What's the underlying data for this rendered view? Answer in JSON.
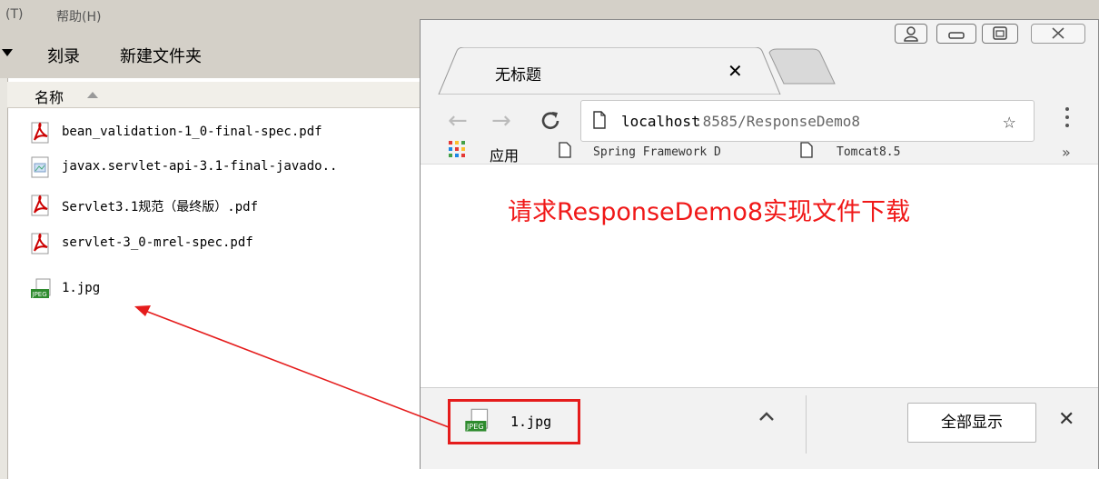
{
  "explorer": {
    "menu": [
      {
        "label": "(T)"
      },
      {
        "label": "帮助(H)"
      }
    ],
    "toolbar": {
      "burn_label": "刻录",
      "new_folder_label": "新建文件夹"
    },
    "column_header": "名称",
    "files": [
      {
        "name": "bean_validation-1_0-final-spec.pdf",
        "icon": "pdf-icon"
      },
      {
        "name": "javax.servlet-api-3.1-final-javado..",
        "icon": "image-file-icon"
      },
      {
        "name": "Servlet3.1规范（最终版）.pdf",
        "icon": "pdf-icon"
      },
      {
        "name": "servlet-3_0-mrel-spec.pdf",
        "icon": "pdf-icon"
      },
      {
        "name": "1.jpg",
        "icon": "jpeg-icon"
      }
    ]
  },
  "browser": {
    "tab_title": "无标题",
    "url_host": "localhost",
    "url_rest": ":8585/ResponseDemo8",
    "bookmarks": {
      "apps_label": "应用",
      "items": [
        "Spring Framework D",
        "Tomcat8.5"
      ],
      "overflow": "»"
    },
    "page_heading": "请求ResponseDemo8实现文件下载",
    "downloads": {
      "file_name": "1.jpg",
      "show_all_label": "全部显示"
    }
  },
  "colors": {
    "heading_red": "#f01818",
    "highlight_red": "#e51c1c",
    "window_frame": "#f2f2f2",
    "explorer_chrome": "#d4d0c8"
  }
}
